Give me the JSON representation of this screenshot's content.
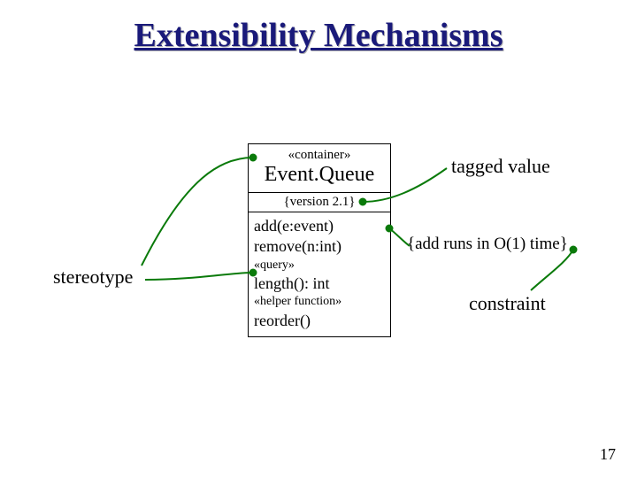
{
  "title": "Extensibility Mechanisms",
  "uml": {
    "header_stereotype": "«container»",
    "class_name": "Event.Queue",
    "tagged_value": "{version 2.1}",
    "ops": {
      "add": "add(e:event)",
      "remove": "remove(n:int)",
      "query_stereo": "«query»",
      "length": "length(): int",
      "helper_stereo": "«helper function»",
      "reorder": "reorder()"
    }
  },
  "labels": {
    "stereotype": "stereotype",
    "tagged_value": "tagged value",
    "constraint_note": "{add runs in O(1) time}",
    "constraint": "constraint"
  },
  "page_number": "17"
}
